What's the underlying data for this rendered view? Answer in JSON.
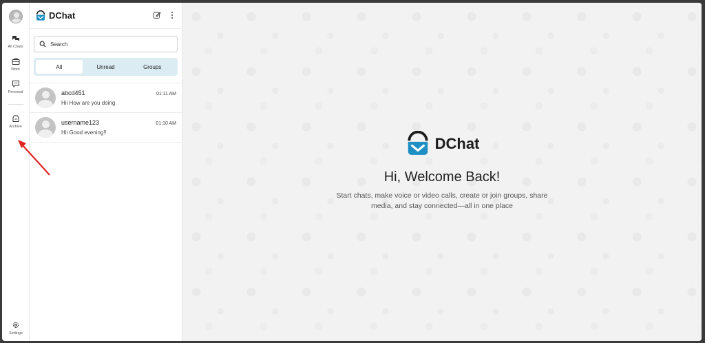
{
  "rail": {
    "items": [
      {
        "label": "All Chats",
        "icon": "chats-icon"
      },
      {
        "label": "Work",
        "icon": "briefcase-icon"
      },
      {
        "label": "Personal",
        "icon": "chat-bubble-icon"
      },
      {
        "label": "Archive",
        "icon": "archive-icon"
      }
    ],
    "settings_label": "Settings"
  },
  "panel": {
    "brand": "DChat",
    "search_placeholder": "Search",
    "tabs": [
      "All",
      "Unread",
      "Groups"
    ],
    "active_tab": "All",
    "chats": [
      {
        "name": "abcd451",
        "message": "Hii How are you doing",
        "time": "01:11 AM"
      },
      {
        "name": "username123",
        "message": "Hii Good evening!!",
        "time": "01:10 AM"
      }
    ]
  },
  "main": {
    "brand": "DChat",
    "title": "Hi, Welcome Back!",
    "subtitle": "Start chats, make voice or video calls, create or join groups, share media, and stay connected—all in one place"
  },
  "colors": {
    "brand_blue": "#1f8fc4",
    "brand_dark": "#1d1d1d",
    "tab_bg": "#dcecf3",
    "annotation_arrow": "#e02424"
  }
}
